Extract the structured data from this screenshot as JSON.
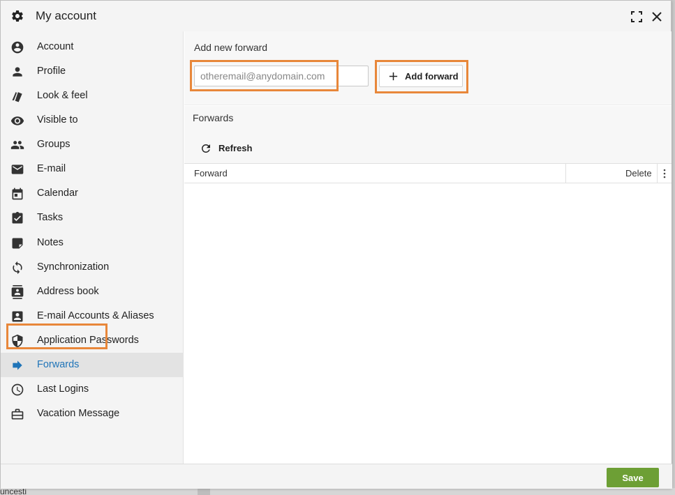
{
  "dialog": {
    "title": "My account",
    "icons": {
      "title": "gear-icon",
      "maximize": "maximize-icon",
      "close": "close-icon"
    }
  },
  "sidebar": {
    "items": [
      {
        "label": "Account",
        "icon": "account-circle-icon",
        "active": false
      },
      {
        "label": "Profile",
        "icon": "person-icon",
        "active": false
      },
      {
        "label": "Look & feel",
        "icon": "style-icon",
        "active": false
      },
      {
        "label": "Visible to",
        "icon": "eye-icon",
        "active": false
      },
      {
        "label": "Groups",
        "icon": "group-icon",
        "active": false
      },
      {
        "label": "E-mail",
        "icon": "mail-icon",
        "active": false
      },
      {
        "label": "Calendar",
        "icon": "calendar-icon",
        "active": false
      },
      {
        "label": "Tasks",
        "icon": "tasks-icon",
        "active": false
      },
      {
        "label": "Notes",
        "icon": "note-icon",
        "active": false
      },
      {
        "label": "Synchronization",
        "icon": "sync-icon",
        "active": false
      },
      {
        "label": "Address book",
        "icon": "address-book-icon",
        "active": false
      },
      {
        "label": "E-mail Accounts & Aliases",
        "icon": "account-box-icon",
        "active": false
      },
      {
        "label": "Application Passwords",
        "icon": "shield-icon",
        "active": false
      },
      {
        "label": "Forwards",
        "icon": "forward-arrow-icon",
        "active": true
      },
      {
        "label": "Last Logins",
        "icon": "clock-icon",
        "active": false
      },
      {
        "label": "Vacation Message",
        "icon": "briefcase-icon",
        "active": false
      }
    ]
  },
  "add_forward": {
    "label": "Add new forward",
    "email_placeholder": "otheremail@anydomain.com",
    "email_value": "",
    "button_label": "Add forward"
  },
  "forwards": {
    "title": "Forwards",
    "refresh_label": "Refresh",
    "columns": {
      "forward": "Forward",
      "delete": "Delete"
    },
    "rows": []
  },
  "footer": {
    "save_label": "Save"
  },
  "background": {
    "partial_text": "uncesti"
  },
  "colors": {
    "accent": "#1f74b8",
    "highlight": "#e8873a",
    "save": "#6d9f35"
  }
}
